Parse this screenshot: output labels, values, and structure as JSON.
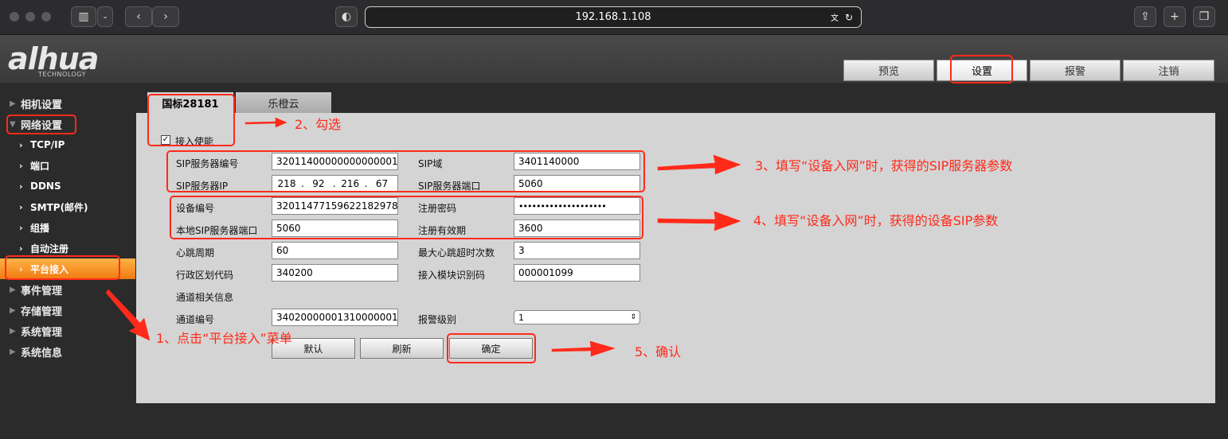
{
  "browser": {
    "url": "192.168.1.108"
  },
  "header": {
    "logo": "alhua",
    "logo_sub": "TECHNOLOGY",
    "nav": [
      "预览",
      "设置",
      "报警",
      "注销"
    ],
    "active_nav": "设置"
  },
  "sidebar": {
    "items": [
      {
        "label": "相机设置"
      },
      {
        "label": "网络设置"
      },
      {
        "label": "TCP/IP"
      },
      {
        "label": "端口"
      },
      {
        "label": "DDNS"
      },
      {
        "label": "SMTP(邮件)"
      },
      {
        "label": "组播"
      },
      {
        "label": "自动注册"
      },
      {
        "label": "平台接入"
      },
      {
        "label": "事件管理"
      },
      {
        "label": "存储管理"
      },
      {
        "label": "系统管理"
      },
      {
        "label": "系统信息"
      }
    ]
  },
  "tabs": [
    "国标28181",
    "乐橙云"
  ],
  "form": {
    "enable_label": "接入使能",
    "enable_checked": true,
    "sip_server_id_label": "SIP服务器编号",
    "sip_server_id": "32011400000000000001",
    "sip_domain_label": "SIP域",
    "sip_domain": "3401140000",
    "sip_server_ip_label": "SIP服务器IP",
    "sip_server_ip": [
      "218",
      "92",
      "216",
      "67"
    ],
    "sip_server_port_label": "SIP服务器端口",
    "sip_server_port": "5060",
    "device_id_label": "设备编号",
    "device_id": "32011477159622182978",
    "reg_password_label": "注册密码",
    "reg_password": "••••••••••••••••••••",
    "local_sip_port_label": "本地SIP服务器端口",
    "local_sip_port": "5060",
    "reg_validity_label": "注册有效期",
    "reg_validity": "3600",
    "heartbeat_label": "心跳周期",
    "heartbeat": "60",
    "max_heartbeat_label": "最大心跳超时次数",
    "max_heartbeat": "3",
    "region_code_label": "行政区划代码",
    "region_code": "340200",
    "module_id_label": "接入模块识别码",
    "module_id": "000001099",
    "channel_info_label": "通道相关信息",
    "channel_id_label": "通道编号",
    "channel_id": "34020000001310000001",
    "alarm_level_label": "报警级别",
    "alarm_level": "1",
    "btn_default": "默认",
    "btn_refresh": "刷新",
    "btn_ok": "确定"
  },
  "annotations": {
    "step1": "1、点击“平台接入”菜单",
    "step2": "2、勾选",
    "step3": "3、填写“设备入网”时，获得的SIP服务器参数",
    "step4": "4、填写“设备入网”时，获得的设备SIP参数",
    "step5": "5、确认",
    "color": "#ff2a1a"
  }
}
